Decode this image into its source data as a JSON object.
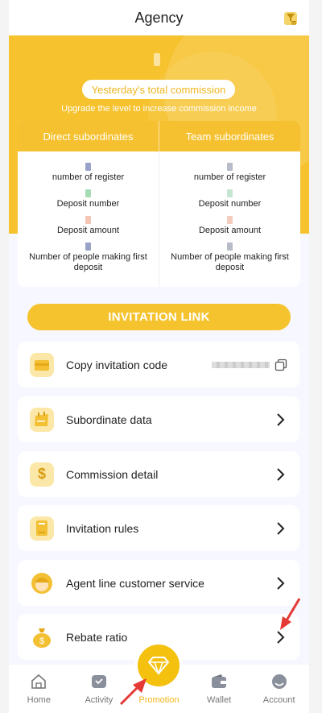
{
  "header": {
    "title": "Agency"
  },
  "hero": {
    "pill_label": "Yesterday's total commission",
    "subtitle": "Upgrade the level to increase commission income"
  },
  "subordinates": {
    "direct_title": "Direct subordinates",
    "team_title": "Team subordinates",
    "stats": [
      "number of register",
      "Deposit number",
      "Deposit amount",
      "Number of people making first deposit"
    ]
  },
  "invite_button": "INVITATION LINK",
  "menu": [
    {
      "label": "Copy invitation code",
      "icon": "ticket-icon"
    },
    {
      "label": "Subordinate data",
      "icon": "calendar-icon"
    },
    {
      "label": "Commission detail",
      "icon": "dollar-icon"
    },
    {
      "label": "Invitation rules",
      "icon": "document-icon"
    },
    {
      "label": "Agent line customer service",
      "icon": "support-agent-icon"
    },
    {
      "label": "Rebate ratio",
      "icon": "money-bag-icon"
    }
  ],
  "tabs": [
    {
      "label": "Home",
      "icon": "home-icon"
    },
    {
      "label": "Activity",
      "icon": "gift-icon"
    },
    {
      "label": "Promotion",
      "icon": "diamond-icon"
    },
    {
      "label": "Wallet",
      "icon": "wallet-icon"
    },
    {
      "label": "Account",
      "icon": "user-icon"
    }
  ],
  "colors": {
    "accent": "#f5c32e",
    "active_tab": "#f2b51d",
    "annotation_arrow": "#e53935"
  }
}
